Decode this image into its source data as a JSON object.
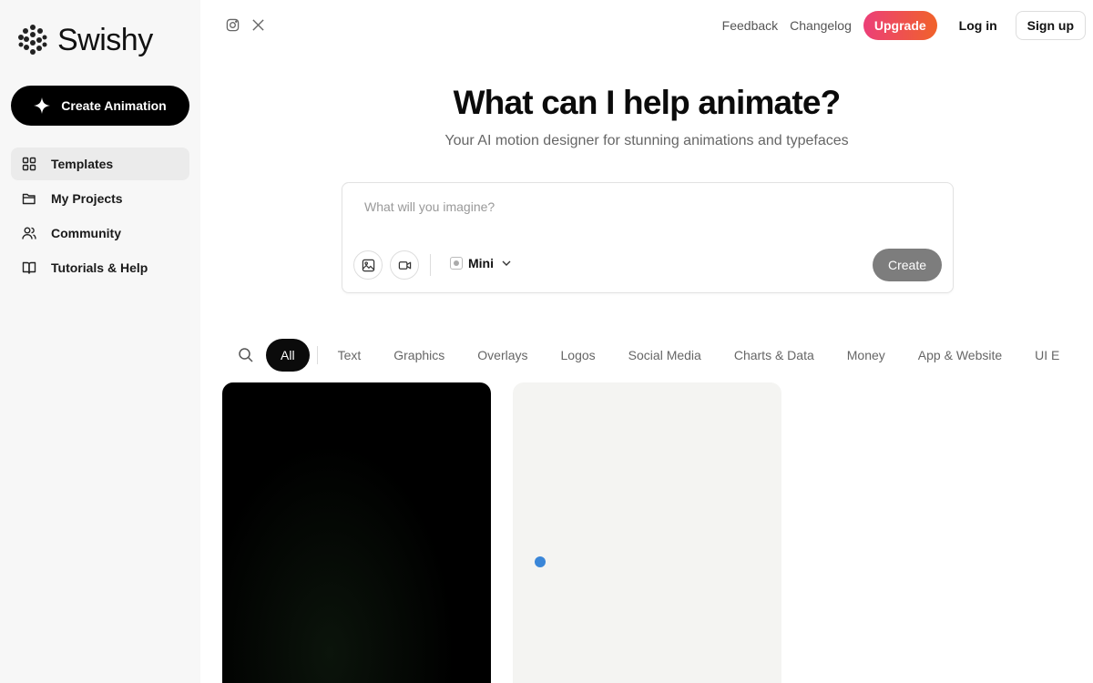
{
  "brand": {
    "name": "Swishy"
  },
  "sidebar": {
    "create_label": "Create Animation",
    "items": [
      {
        "label": "Templates",
        "icon": "grid-icon",
        "active": true
      },
      {
        "label": "My Projects",
        "icon": "folder-icon"
      },
      {
        "label": "Community",
        "icon": "users-icon"
      },
      {
        "label": "Tutorials & Help",
        "icon": "book-icon"
      }
    ]
  },
  "header": {
    "social": [
      "instagram-icon",
      "x-icon"
    ],
    "feedback": "Feedback",
    "changelog": "Changelog",
    "upgrade": "Upgrade",
    "login": "Log in",
    "signup": "Sign up",
    "upgrade_gradient": [
      "#ec3f78",
      "#f0622a"
    ]
  },
  "hero": {
    "title": "What can I help animate?",
    "subtitle": "Your AI motion designer for stunning animations and typefaces"
  },
  "prompt": {
    "placeholder": "What will you imagine?",
    "model": "Mini",
    "submit": "Create"
  },
  "filters": {
    "items": [
      "All",
      "Text",
      "Graphics",
      "Overlays",
      "Logos",
      "Social Media",
      "Charts & Data",
      "Money",
      "App & Website",
      "UI E"
    ],
    "active": "All"
  },
  "colors": {
    "accent_blue": "#3a86d8",
    "dark": "#0b0b0b"
  }
}
